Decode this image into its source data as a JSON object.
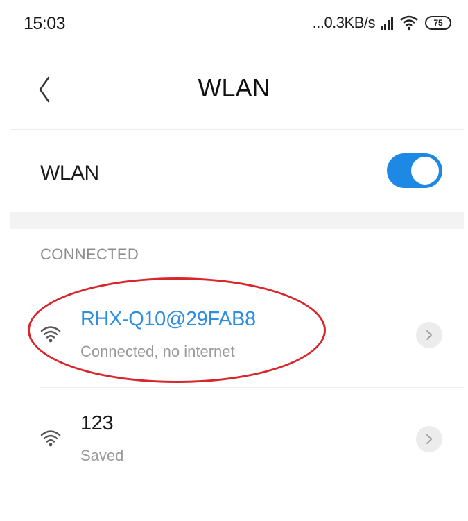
{
  "status_bar": {
    "time": "15:03",
    "network_speed": "...0.3KB/s",
    "battery": "75"
  },
  "header": {
    "title": "WLAN",
    "back_icon": "chevron-left-icon"
  },
  "wlan_toggle": {
    "label": "WLAN",
    "enabled": true,
    "accent_color": "#1e88e5"
  },
  "connected_section": {
    "header": "CONNECTED"
  },
  "networks": [
    {
      "name": "RHX-Q10@29FAB8",
      "status": "Connected, no internet",
      "name_color": "#2f8ee0",
      "highlighted": true
    },
    {
      "name": "123",
      "status": "Saved",
      "name_color": "#1a1a1a",
      "highlighted": false
    }
  ],
  "annotation_color": "#d8262c"
}
